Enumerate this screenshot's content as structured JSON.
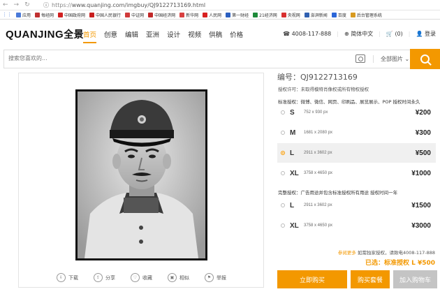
{
  "browser": {
    "url_scheme": "https://",
    "url_rest": "www.quanjing.com/imgbuy/QJ9122713169.html",
    "bookmarks": [
      {
        "label": "应用",
        "color": "#4a7ad9"
      },
      {
        "label": "每经网",
        "color": "#c03030"
      },
      {
        "label": "中国政府网",
        "color": "#d02020"
      },
      {
        "label": "中国人民银行",
        "color": "#c81e1e"
      },
      {
        "label": "中证网",
        "color": "#d03a3a"
      },
      {
        "label": "中国经济网",
        "color": "#c02828"
      },
      {
        "label": "新华网",
        "color": "#d84040"
      },
      {
        "label": "人民网",
        "color": "#d82020"
      },
      {
        "label": "第一财经",
        "color": "#2b5fc0"
      },
      {
        "label": "21经济网",
        "color": "#1e8a3a"
      },
      {
        "label": "央视网",
        "color": "#d83030"
      },
      {
        "label": "澎湃新闻",
        "color": "#3060b0"
      },
      {
        "label": "百度",
        "color": "#2b66d8"
      },
      {
        "label": "后台管理系统",
        "color": "#d89a20"
      }
    ]
  },
  "header": {
    "logo_en": "QUANJING",
    "logo_cn": "全景",
    "nav": [
      "首页",
      "创意",
      "编辑",
      "亚洲",
      "设计",
      "视频",
      "供稿",
      "价格"
    ],
    "phone": "4008-117-888",
    "lang": "简体中文",
    "cart": "(0)",
    "login": "登录"
  },
  "search": {
    "placeholder": "搜索您喜欢的...",
    "category": "全部图片"
  },
  "image_tools": [
    "下载",
    "分享",
    "收藏",
    "相似",
    "举报"
  ],
  "product": {
    "code": "编号：QJ9122713169",
    "permit": "授权许可：未取得模特肖像权或所有物权授权",
    "standard_label": "标准授权：微博、微信、网页、印刷品、展览展示、POP 授权时间永久",
    "standard_options": [
      {
        "size": "S",
        "px": "752 x 930 px",
        "price": "¥200",
        "selected": false
      },
      {
        "size": "M",
        "px": "1681 x 2080 px",
        "price": "¥300",
        "selected": false
      },
      {
        "size": "L",
        "px": "2911 x 3602 px",
        "price": "¥500",
        "selected": true
      },
      {
        "size": "XL",
        "px": "3758 x 4650 px",
        "price": "¥1000",
        "selected": false
      }
    ],
    "extended_label": "完整授权：广告用途并包含标准授权所有用途 授权时间一年",
    "extended_options": [
      {
        "size": "L",
        "px": "2911 x 3602 px",
        "price": "¥1500",
        "selected": false
      },
      {
        "size": "XL",
        "px": "3758 x 4650 px",
        "price": "¥3000",
        "selected": false
      }
    ],
    "note_link": "参阅更多",
    "note_text": "如需独家授权，请致电4008-117-888",
    "chosen": "已选：标准授权 L ¥500",
    "buy_button": "立即购买",
    "package_button": "购买套餐",
    "cart_button": "加入购物车"
  },
  "colors": {
    "accent": "#f39800",
    "disabled": "#c4c4c4"
  }
}
